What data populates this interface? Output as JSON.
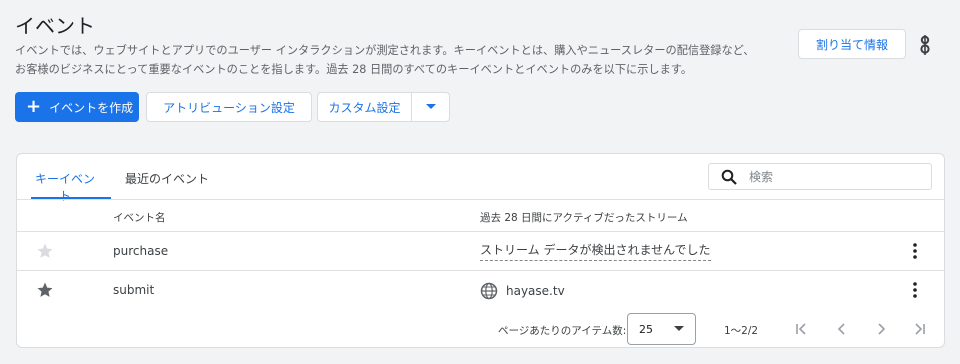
{
  "header": {
    "title": "イベント",
    "description_line1": "イベントでは、ウェブサイトとアプリでのユーザー インタラクションが測定されます。キーイベントとは、購入やニュースレターの配信登録など、",
    "description_line2": "お客様のビジネスにとって重要なイベントのことを指します。過去 28 日間のすべてのキーイベントとイベントのみを以下に示します。",
    "assign_button": "割り当て情報"
  },
  "toolbar": {
    "create_label": "イベントを作成",
    "attribution_label": "アトリビューション設定",
    "custom_label": "カスタム設定"
  },
  "card": {
    "tabs": [
      {
        "label": "キーイベント",
        "active": true
      },
      {
        "label": "最近のイベント",
        "active": false
      }
    ],
    "search_placeholder": "検索",
    "columns": {
      "name": "イベント名",
      "stream": "過去 28 日間にアクティブだったストリーム"
    },
    "rows": [
      {
        "name": "purchase",
        "stream": "ストリーム データが検出されませんでした",
        "starred": false
      },
      {
        "name": "submit",
        "stream": "hayase.tv",
        "starred": true
      }
    ],
    "pagination": {
      "label": "ページあたりのアイテム数:",
      "page_size": "25",
      "range": "1〜2/2"
    }
  },
  "colors": {
    "accent": "#1a73e8",
    "star_empty": "#dadce0",
    "star_filled": "#5f6368"
  }
}
